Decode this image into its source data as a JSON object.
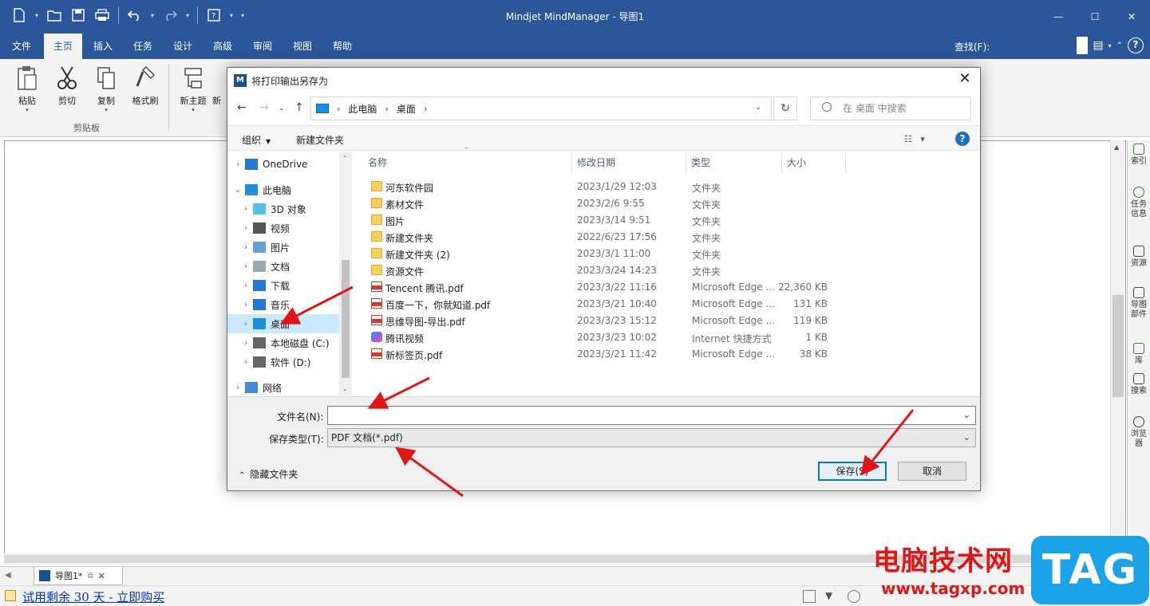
{
  "app": {
    "title": "Mindjet MindManager - 导图1",
    "colors": {
      "accent": "#2b579a",
      "ribbon_bg": "#f3f3f3",
      "dialog_primary": "#0078d7",
      "annotation_red": "#e21515"
    }
  },
  "quick_access": {
    "icons": [
      "new-icon",
      "open-icon",
      "save-icon",
      "print-icon",
      "undo-icon",
      "redo-icon",
      "help-icon"
    ]
  },
  "window_controls": {
    "minimize": "—",
    "maximize": "☐",
    "close": "✕"
  },
  "ribbon_tabs": [
    "文件",
    "主页",
    "插入",
    "任务",
    "设计",
    "高级",
    "审阅",
    "视图",
    "帮助"
  ],
  "active_tab": "主页",
  "find_label": "查找(F):",
  "ribbon": {
    "buttons": [
      "粘贴",
      "剪切",
      "复制",
      "格式刷",
      "新主题",
      "新"
    ],
    "group_clipboard": "剪贴板"
  },
  "side_pane": [
    "索引",
    "任务信息",
    "资源",
    "导图部件",
    "库",
    "搜索",
    "浏览器"
  ],
  "doc_tab": {
    "label": "导图1*"
  },
  "status": {
    "trial_text": "试用剩余 30 天 - 立即购买"
  },
  "watermark": {
    "text": "电脑技术网",
    "url": "www.tagxp.com",
    "logo": "TAG"
  },
  "dialog": {
    "title": "将打印输出另存为",
    "close": "✕",
    "breadcrumb": [
      "此电脑",
      "桌面"
    ],
    "search_placeholder": "在 桌面 中搜索",
    "toolbar": {
      "organize": "组织",
      "new_folder": "新建文件夹",
      "help": "?"
    },
    "nav": [
      {
        "label": "OneDrive",
        "expand": "›",
        "icon": "onedrive-icon"
      },
      {
        "label": "此电脑",
        "expand": "⌄",
        "icon": "this-pc-icon"
      },
      {
        "label": "3D 对象",
        "expand": "›",
        "icon": "3d-objects-icon"
      },
      {
        "label": "视频",
        "expand": "›",
        "icon": "videos-icon"
      },
      {
        "label": "图片",
        "expand": "›",
        "icon": "pictures-icon"
      },
      {
        "label": "文档",
        "expand": "›",
        "icon": "documents-icon"
      },
      {
        "label": "下载",
        "expand": "›",
        "icon": "downloads-icon"
      },
      {
        "label": "音乐",
        "expand": "›",
        "icon": "music-icon"
      },
      {
        "label": "桌面",
        "expand": "›",
        "icon": "desktop-icon"
      },
      {
        "label": "本地磁盘 (C:)",
        "expand": "›",
        "icon": "drive-c-icon"
      },
      {
        "label": "软件 (D:)",
        "expand": "›",
        "icon": "drive-d-icon"
      },
      {
        "label": "网络",
        "expand": "›",
        "icon": "network-icon"
      }
    ],
    "columns": {
      "name": "名称",
      "date": "修改日期",
      "type": "类型",
      "size": "大小"
    },
    "files": [
      {
        "name": "河东软件园",
        "date": "2023/1/29 12:03",
        "type": "文件夹",
        "size": "",
        "icon": "folder"
      },
      {
        "name": "素材文件",
        "date": "2023/2/6 9:55",
        "type": "文件夹",
        "size": "",
        "icon": "folder"
      },
      {
        "name": "图片",
        "date": "2023/3/14 9:51",
        "type": "文件夹",
        "size": "",
        "icon": "folder"
      },
      {
        "name": "新建文件夹",
        "date": "2022/6/23 17:56",
        "type": "文件夹",
        "size": "",
        "icon": "folder"
      },
      {
        "name": "新建文件夹 (2)",
        "date": "2023/3/1 11:00",
        "type": "文件夹",
        "size": "",
        "icon": "folder"
      },
      {
        "name": "资源文件",
        "date": "2023/3/24 14:23",
        "type": "文件夹",
        "size": "",
        "icon": "folder"
      },
      {
        "name": "Tencent 腾讯.pdf",
        "date": "2023/3/22 11:16",
        "type": "Microsoft Edge ...",
        "size": "22,360 KB",
        "icon": "pdf"
      },
      {
        "name": "百度一下，你就知道.pdf",
        "date": "2023/3/21 10:40",
        "type": "Microsoft Edge ...",
        "size": "131 KB",
        "icon": "pdf"
      },
      {
        "name": "思维导图-导出.pdf",
        "date": "2023/3/23 15:12",
        "type": "Microsoft Edge ...",
        "size": "119 KB",
        "icon": "pdf"
      },
      {
        "name": "腾讯视频",
        "date": "2023/3/23 10:02",
        "type": "Internet 快捷方式",
        "size": "1 KB",
        "icon": "lnk"
      },
      {
        "name": "新标签页.pdf",
        "date": "2023/3/21 11:42",
        "type": "Microsoft Edge ...",
        "size": "38 KB",
        "icon": "pdf"
      }
    ],
    "filename_label": "文件名(N):",
    "filename_value": "",
    "savetype_label": "保存类型(T):",
    "savetype_value": "PDF 文档(*.pdf)",
    "hide_folders": "隐藏文件夹",
    "save_button": "保存(S)",
    "cancel_button": "取消"
  }
}
